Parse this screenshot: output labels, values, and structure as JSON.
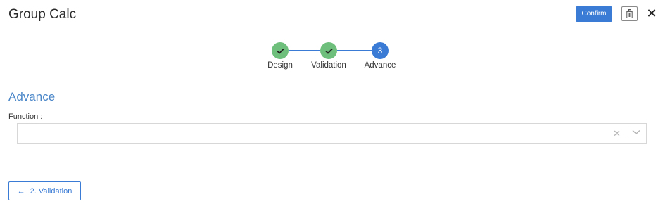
{
  "header": {
    "title": "Group Calc",
    "confirm_label": "Confirm"
  },
  "icons": {
    "trash": "trash-icon",
    "close": "close-icon",
    "check": "check-icon",
    "clear": "clear-x-icon",
    "dropdown": "chevron-down-icon",
    "back": "arrow-left-icon",
    "close_glyph": "✕",
    "clear_glyph": "✕",
    "back_glyph": "←"
  },
  "stepper": {
    "steps": [
      {
        "label": "Design",
        "state": "done"
      },
      {
        "label": "Validation",
        "state": "done"
      },
      {
        "label": "Advance",
        "state": "active",
        "number": "3"
      }
    ]
  },
  "section": {
    "title": "Advance"
  },
  "form": {
    "function_label": "Function :",
    "function_value": ""
  },
  "footer": {
    "back_label": "2. Validation"
  },
  "colors": {
    "accent": "#3a7bd5",
    "done": "#6dbf7b",
    "section_title": "#4a86c8"
  }
}
